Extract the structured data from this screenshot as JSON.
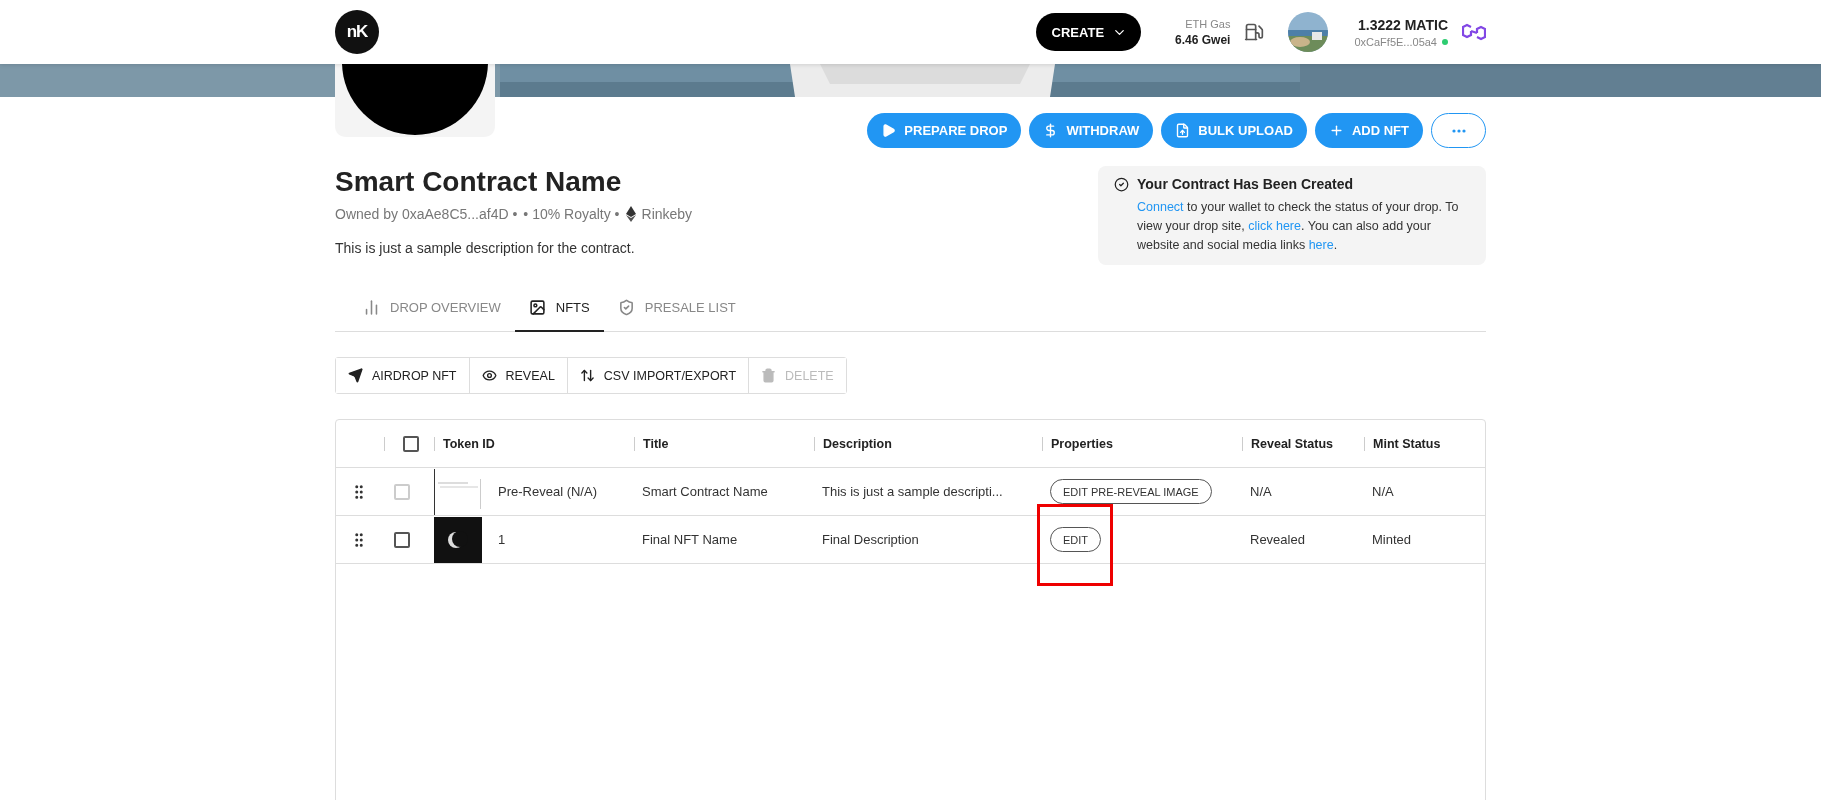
{
  "header": {
    "logo": "nK",
    "create_button": "CREATE",
    "gas_label": "ETH Gas",
    "gas_value": "6.46 Gwei",
    "balance": "1.3222 MATIC",
    "address": "0xCaFf5E...05a4",
    "connected": true
  },
  "actions": [
    {
      "kind": "button",
      "label": "PREPARE DROP"
    },
    {
      "kind": "button",
      "label": "WITHDRAW"
    },
    {
      "kind": "button",
      "label": "BULK UPLOAD"
    },
    {
      "kind": "button",
      "label": "ADD NFT"
    },
    {
      "kind": "more"
    }
  ],
  "contract": {
    "name": "Smart Contract Name",
    "owner": "Owned by 0xaAe8C5...af4D •",
    "royalty": "• 10% Royalty •",
    "network": "Rinkeby",
    "description": "This is just a sample description for the contract."
  },
  "notice": {
    "title": "Your Contract Has Been Created",
    "segments": [
      {
        "kind": "link",
        "text": "Connect"
      },
      {
        "kind": "text",
        "text": " to your wallet to check the status of your drop. To view your drop site, "
      },
      {
        "kind": "link",
        "text": "click here"
      },
      {
        "kind": "text",
        "text": ". You can also add your website and social media links "
      },
      {
        "kind": "link",
        "text": "here"
      },
      {
        "kind": "text",
        "text": "."
      }
    ]
  },
  "tabs": [
    {
      "label": "DROP OVERVIEW",
      "selected": false
    },
    {
      "label": "NFTS",
      "selected": true
    },
    {
      "label": "PRESALE LIST",
      "selected": false
    }
  ],
  "toolbar": [
    {
      "label": "AIRDROP NFT",
      "disabled": false
    },
    {
      "label": "REVEAL",
      "disabled": false
    },
    {
      "label": "CSV IMPORT/EXPORT",
      "disabled": false
    },
    {
      "label": "DELETE",
      "disabled": true
    }
  ],
  "table": {
    "select_all_checked": false,
    "columns": [
      "Token ID",
      "Title",
      "Description",
      "Properties",
      "Reveal Status",
      "Mint Status"
    ],
    "rows": [
      {
        "checked": false,
        "disabled": true,
        "token_id": "Pre-Reveal (N/A)",
        "title": "Smart Contract Name",
        "description": "This is just a sample descripti...",
        "action": "EDIT PRE-REVEAL IMAGE",
        "highlighted": false,
        "reveal_status": "N/A",
        "mint_status": "N/A"
      },
      {
        "checked": false,
        "disabled": false,
        "token_id": "1",
        "title": "Final NFT Name",
        "description": "Final Description",
        "action": "EDIT",
        "highlighted": true,
        "reveal_status": "Revealed",
        "mint_status": "Minted"
      }
    ]
  }
}
